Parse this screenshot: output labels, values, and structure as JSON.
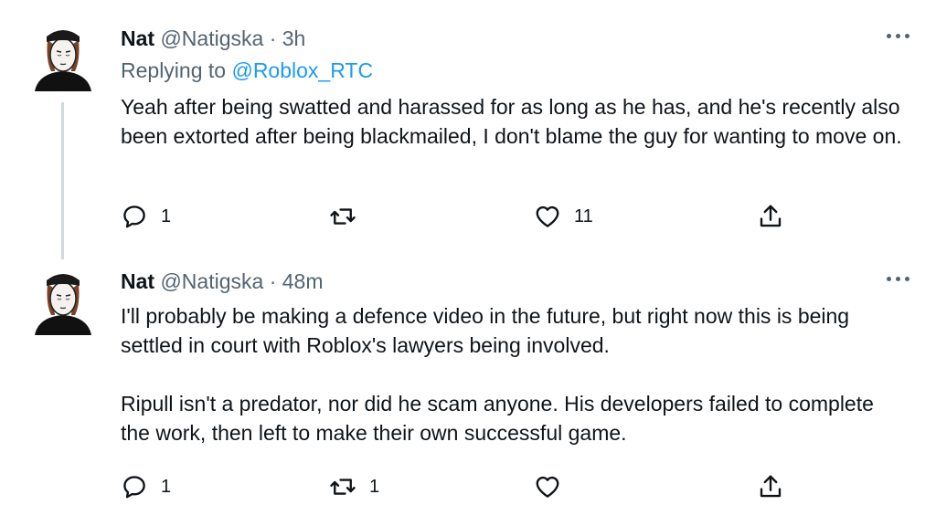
{
  "tweets": [
    {
      "name": "Nat",
      "handle": "@Natigska",
      "separator": "·",
      "time": "3h",
      "replying_prefix": "Replying to",
      "replying_to": "@Roblox_RTC",
      "body": [
        "Yeah after being swatted and harassed for as long as he has, and he's recently also been extorted after being blackmailed, I don't blame the guy for wanting to move on."
      ],
      "actions": {
        "replies": "1",
        "retweets": "",
        "likes": "11"
      }
    },
    {
      "name": "Nat",
      "handle": "@Natigska",
      "separator": "·",
      "time": "48m",
      "body": [
        "I'll probably be making a defence video in the future, but right now this is being settled in court with Roblox's lawyers being involved.",
        "Ripull isn't a predator, nor did he scam anyone. His developers failed to complete the work, then left to make their own successful game."
      ],
      "actions": {
        "replies": "1",
        "retweets": "1",
        "likes": ""
      }
    }
  ],
  "colors": {
    "text": "#0f1419",
    "secondary": "#536471",
    "link": "#1d9bf0",
    "thread_line": "#cfd9de"
  },
  "icons": [
    "avatar-drawing",
    "more-dots-icon",
    "reply-icon",
    "retweet-icon",
    "like-icon",
    "share-icon"
  ]
}
